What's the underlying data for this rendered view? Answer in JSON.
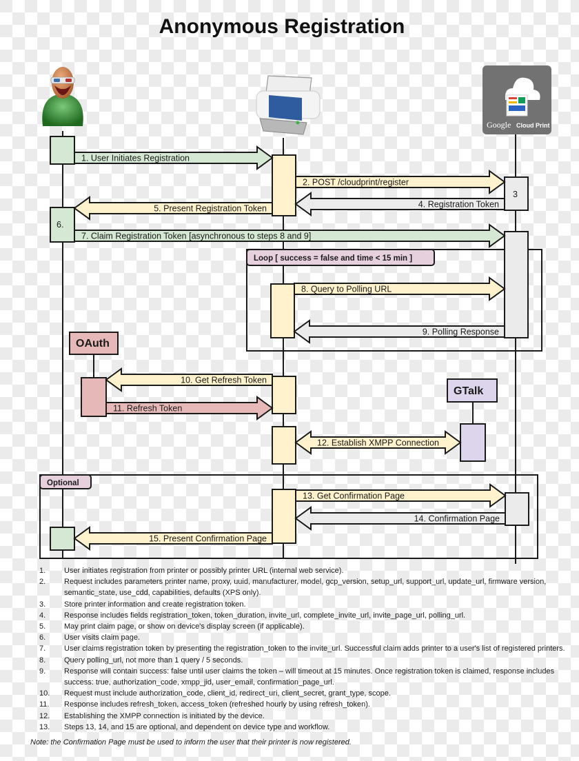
{
  "title": "Anonymous Registration",
  "colors": {
    "user": "#d5e8d4",
    "printer": "#fff2cc",
    "cloud": "#ebebeb",
    "oauth": "#e6b8b7",
    "gtalk": "#dcd5ec",
    "frame_tag": "#e6d0de",
    "stroke": "#1a1a1a"
  },
  "actors": {
    "user": {
      "icon": "user-avatar-icon"
    },
    "printer": {
      "icon": "printer-icon"
    },
    "cloud": {
      "icon": "google-cloud-print-logo",
      "logo_word": "Google",
      "logo_text": "Cloud Print"
    },
    "oauth": {
      "label": "OAuth"
    },
    "gtalk": {
      "label": "GTalk"
    }
  },
  "activations": {
    "cloud_3": "3",
    "user_6": "6."
  },
  "frames": {
    "loop": "Loop  [ success = false and time < 15 min ]",
    "optional": "Optional"
  },
  "messages": [
    {
      "id": "m1",
      "label": "1. User Initiates Registration"
    },
    {
      "id": "m2",
      "label": "2. POST /cloudprint/register"
    },
    {
      "id": "m4",
      "label": "4. Registration Token"
    },
    {
      "id": "m5",
      "label": "5. Present Registration Token"
    },
    {
      "id": "m7",
      "label": "7. Claim Registration Token [asynchronous to steps 8 and 9]"
    },
    {
      "id": "m8",
      "label": "8. Query to Polling URL"
    },
    {
      "id": "m9",
      "label": "9. Polling Response"
    },
    {
      "id": "m10",
      "label": "10. Get Refresh Token"
    },
    {
      "id": "m11",
      "label": "11. Refresh Token"
    },
    {
      "id": "m12",
      "label": "12. Establish XMPP Connection"
    },
    {
      "id": "m13",
      "label": "13. Get Confirmation Page"
    },
    {
      "id": "m14",
      "label": "14. Confirmation Page"
    },
    {
      "id": "m15",
      "label": "15. Present Confirmation Page"
    }
  ],
  "notes": [
    {
      "num": "1.",
      "text": "User initiates registration from printer or possibly printer URL (internal web service)."
    },
    {
      "num": "2.",
      "text": "Request includes parameters printer name, proxy, uuid, manufacturer, model, gcp_version, setup_url, support_url, update_url, firmware version, semantic_state, use_cdd, capabilities, defaults (XPS only)."
    },
    {
      "num": "3.",
      "text": "Store printer information and create registration token."
    },
    {
      "num": "4.",
      "text": "Response includes fields registration_token, token_duration, invite_url, complete_invite_url, invite_page_url, polling_url."
    },
    {
      "num": "5.",
      "text": "May print claim page, or show on device's display screen (if applicable)."
    },
    {
      "num": "6.",
      "text": "User visits claim page."
    },
    {
      "num": "7.",
      "text": "User claims registration token by presenting the registration_token to the invite_url. Successful claim adds printer to a user's list of registered printers."
    },
    {
      "num": "8.",
      "text": "Query polling_url, not more than 1 query / 5 seconds."
    },
    {
      "num": "9.",
      "text": "Response will contain success: false until user claims the token – will timeout at 15 minutes. Once registration token is claimed, response includes success: true, authorization_code, xmpp_jid, user_email, confirmation_page_url."
    },
    {
      "num": "10.",
      "text": "Request must include authorization_code, client_id, redirect_uri, client_secret, grant_type, scope."
    },
    {
      "num": "11.",
      "text": "Response includes refresh_token, access_token (refreshed hourly by using refresh_token)."
    },
    {
      "num": "12.",
      "text": "Establishing the XMPP connection is initiated by the device."
    },
    {
      "num": "13.",
      "text": "Steps 13, 14, and 15 are optional, and dependent on device type and workflow."
    }
  ],
  "footnote": "Note: the Confirmation Page must be used to inform the user that their printer is now registered."
}
